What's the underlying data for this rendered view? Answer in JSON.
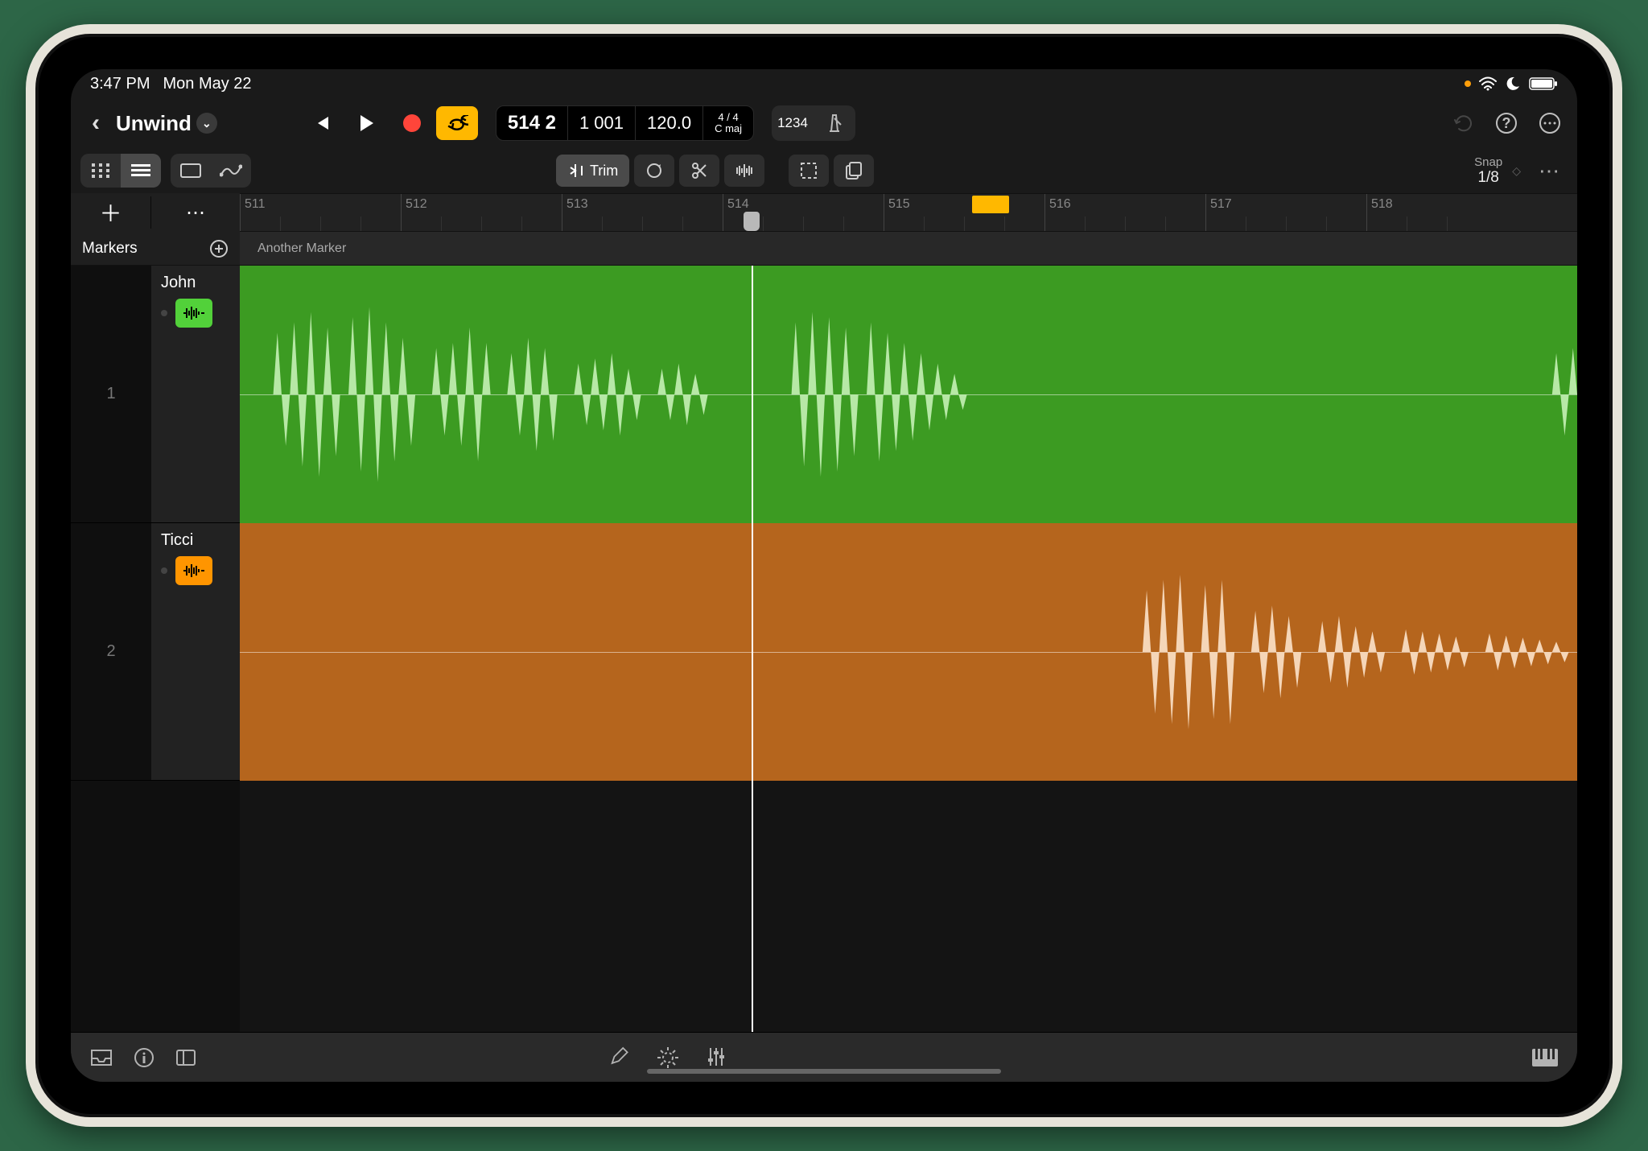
{
  "status": {
    "time": "3:47 PM",
    "date": "Mon May 22"
  },
  "project": {
    "title": "Unwind"
  },
  "lcd": {
    "position": "514 2",
    "beat": "1 001",
    "tempo": "120.0",
    "sig_top": "4 / 4",
    "sig_bottom": "C maj",
    "display_mode": "1234"
  },
  "trim": {
    "label": "Trim"
  },
  "snap": {
    "label": "Snap",
    "value": "1/8"
  },
  "ruler": {
    "bars": [
      "511",
      "512",
      "513",
      "514",
      "515",
      "516",
      "517",
      "518"
    ]
  },
  "markers": {
    "label": "Markers",
    "items": [
      "Another Marker"
    ]
  },
  "tracks": [
    {
      "num": "1",
      "name": "John",
      "color": "green"
    },
    {
      "num": "2",
      "name": "Ticci",
      "color": "orange"
    }
  ]
}
